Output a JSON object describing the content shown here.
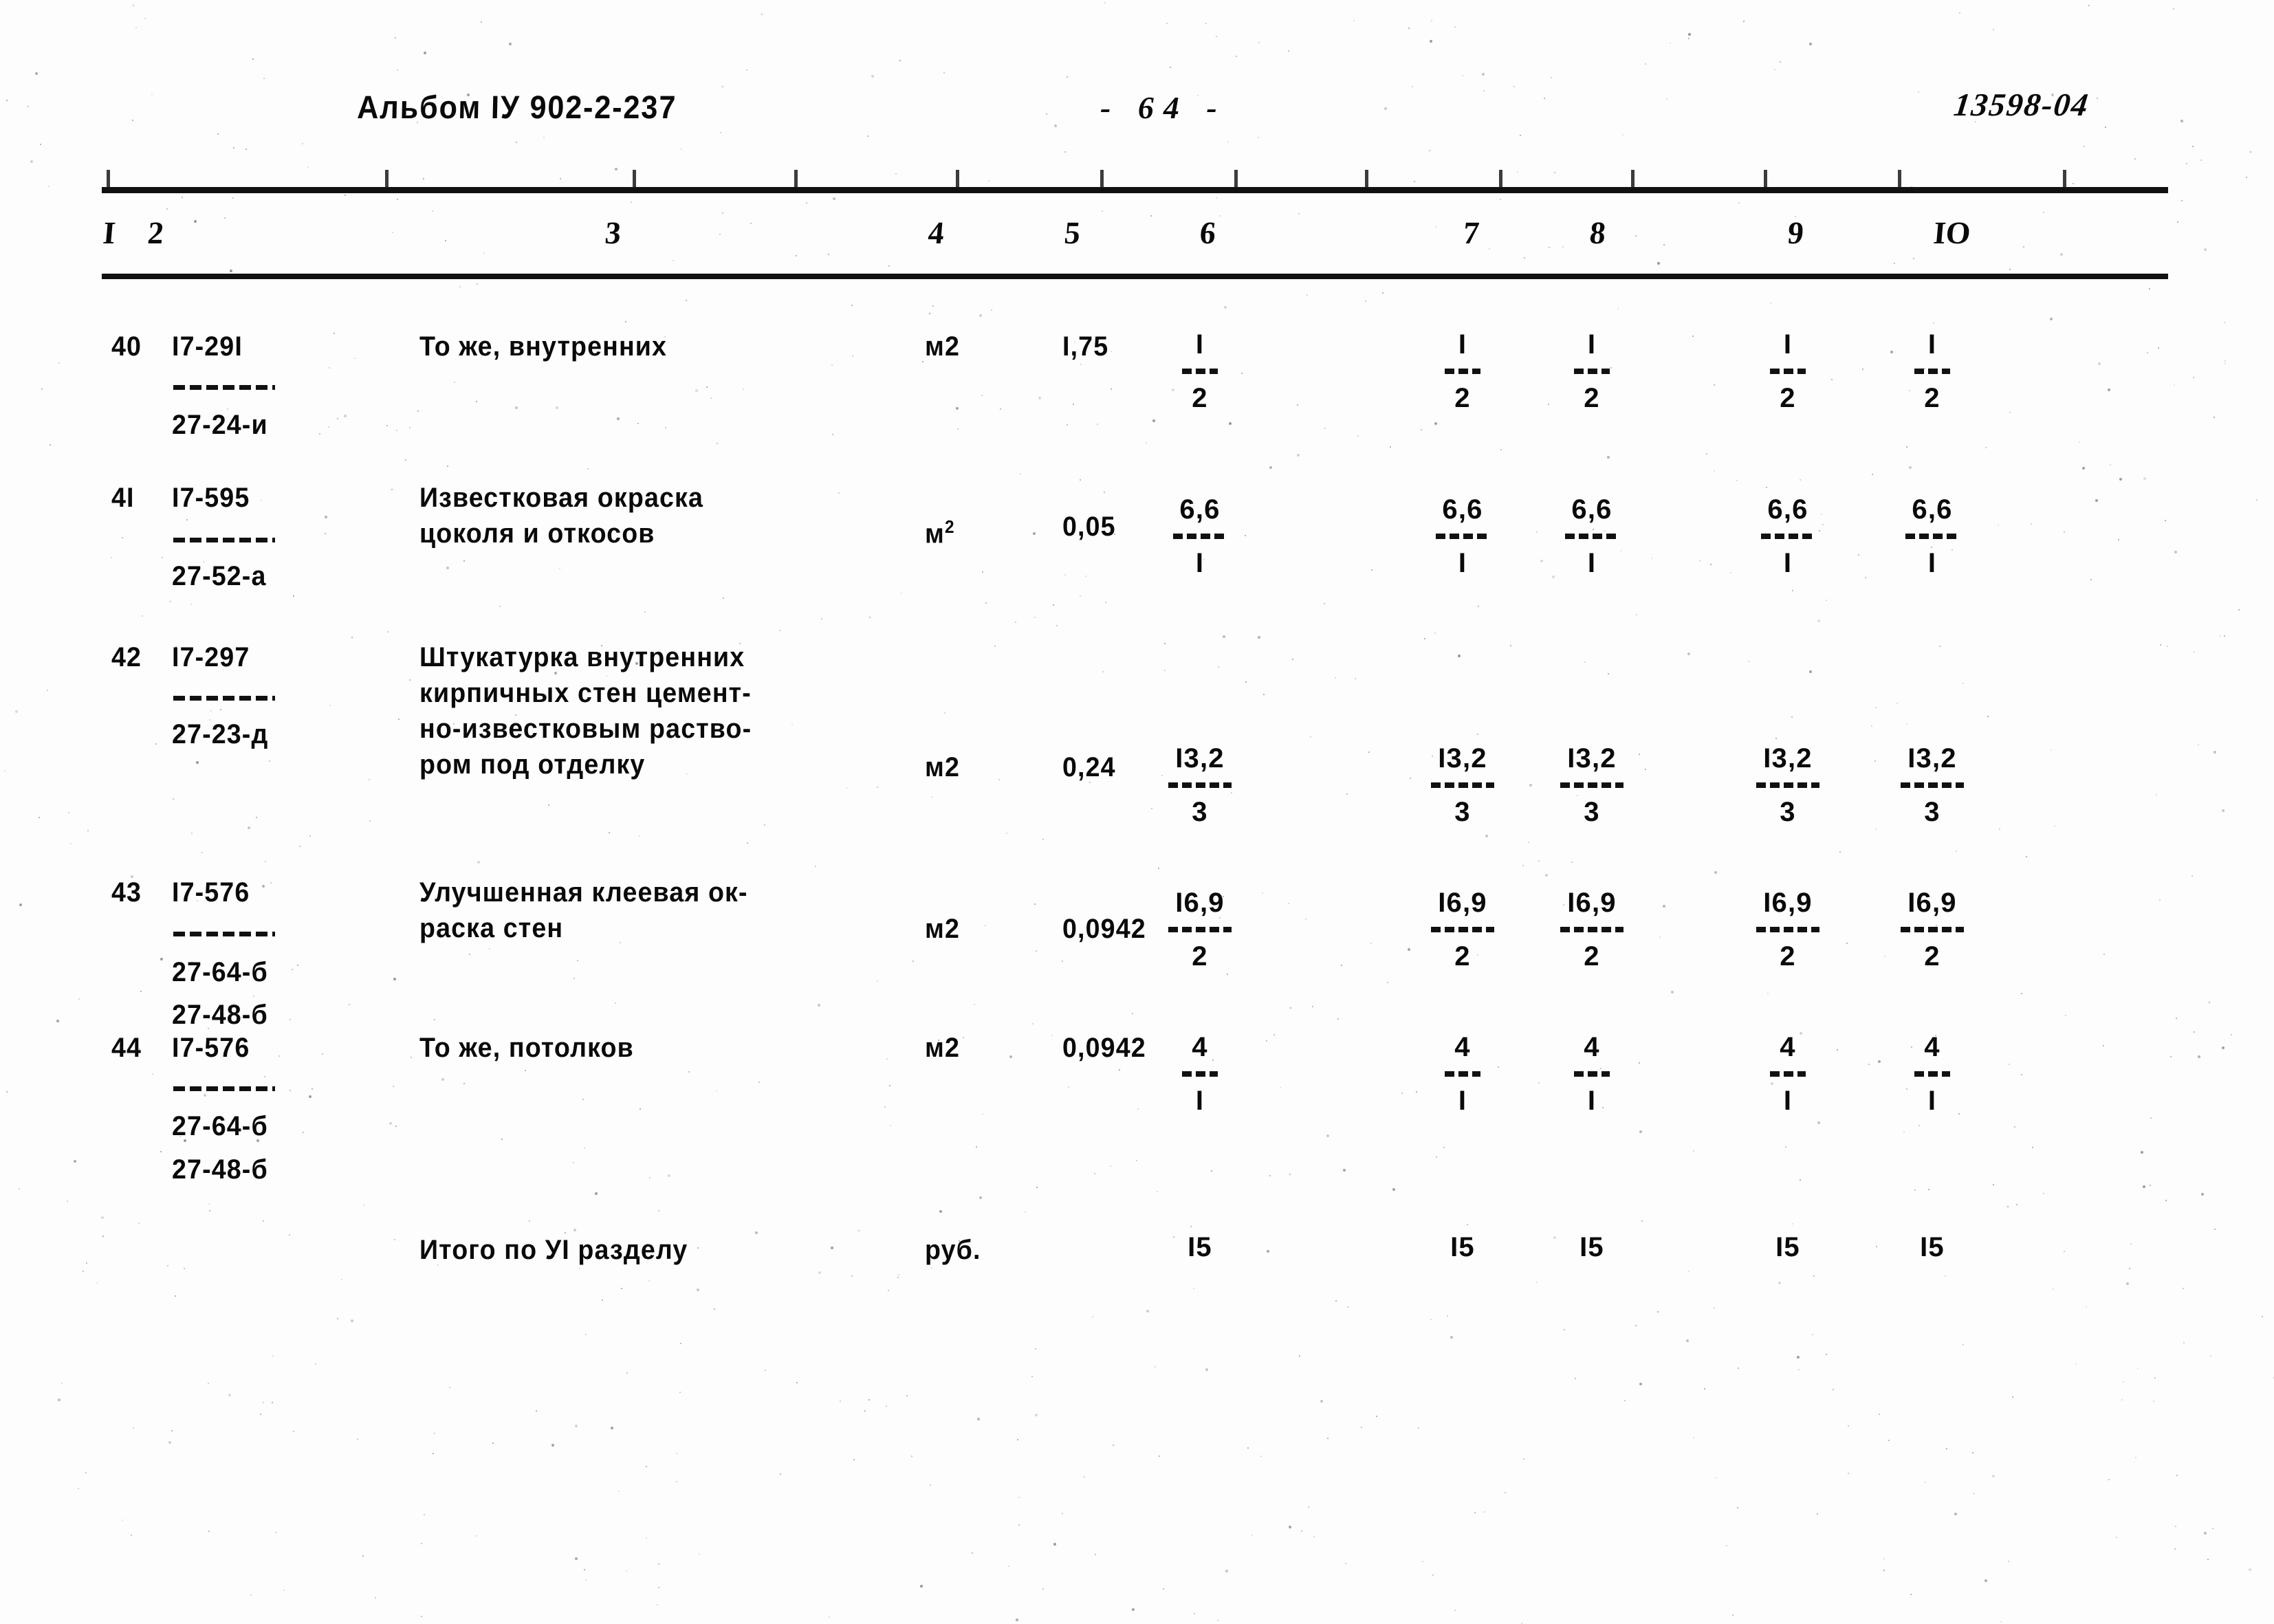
{
  "header": {
    "album": "Альбом IУ 902-2-237",
    "page_number": "- 64 -",
    "doc_code": "13598-04"
  },
  "table": {
    "column_headers": [
      "I",
      "2",
      "3",
      "4",
      "5",
      "6",
      "7",
      "8",
      "9",
      "IO"
    ],
    "rows": [
      {
        "num": "40",
        "code_top": "I7-29I",
        "code_bottom": "27-24-и",
        "description": "То же, внутренних",
        "unit": "м2",
        "unit_sup": "",
        "quantity": "I,75",
        "numerator": "I",
        "denominator": "2",
        "bar_width": "w2"
      },
      {
        "num": "4I",
        "code_top": "I7-595",
        "code_bottom": "27-52-а",
        "description": "Известковая окраска\nцоколя и откосов",
        "unit": "м",
        "unit_sup": "2",
        "quantity": "0,05",
        "numerator": "6,6",
        "denominator": "I",
        "bar_width": "w3"
      },
      {
        "num": "42",
        "code_top": "I7-297",
        "code_bottom": "27-23-д",
        "description": "Штукатурка внутренних\nкирпичных стен цемент-\nно-известковым раство-\nром под отделку",
        "unit": "м2",
        "unit_sup": "",
        "quantity": "0,24",
        "numerator": "I3,2",
        "denominator": "3",
        "bar_width": "w4"
      },
      {
        "num": "43",
        "code_top": "I7-576",
        "code_bottom": "27-64-б",
        "code_bottom2": "27-48-б",
        "description": "Улучшенная клеевая ок-\nраска стен",
        "unit": "м2",
        "unit_sup": "",
        "quantity": "0,0942",
        "numerator": "I6,9",
        "denominator": "2",
        "bar_width": "w4"
      },
      {
        "num": "44",
        "code_top": "I7-576",
        "code_bottom": "27-64-б",
        "code_bottom2": "27-48-б",
        "description": "То же, потолков",
        "unit": "м2",
        "unit_sup": "",
        "quantity": "0,0942",
        "numerator": "4",
        "denominator": "I",
        "bar_width": "w2"
      }
    ],
    "total_row": {
      "description": "Итого по УI разделу",
      "unit": "руб.",
      "value": "I5"
    }
  }
}
